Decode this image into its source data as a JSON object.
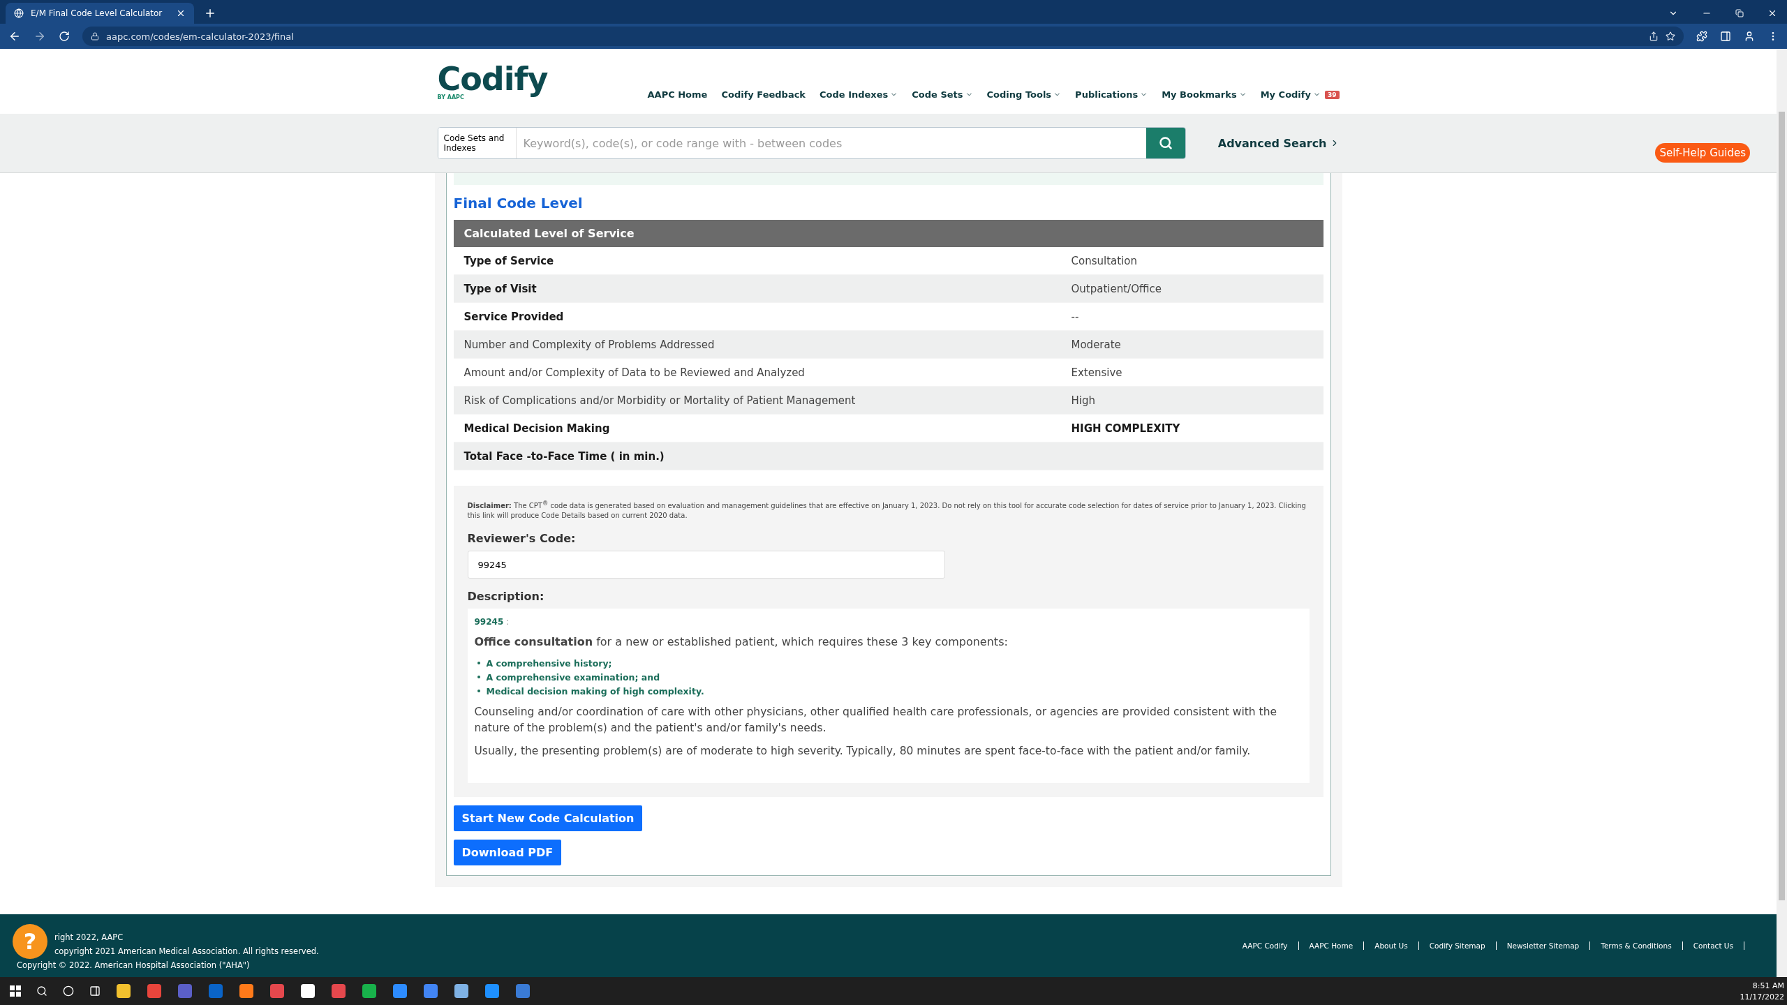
{
  "browser": {
    "tab_title": "E/M Final Code Level Calculator",
    "url": "aapc.com/codes/em-calculator-2023/final"
  },
  "header": {
    "logo": "Codify",
    "logo_sub": "BY AAPC",
    "nav": [
      {
        "label": "AAPC Home",
        "dropdown": false
      },
      {
        "label": "Codify Feedback",
        "dropdown": false
      },
      {
        "label": "Code Indexes",
        "dropdown": true
      },
      {
        "label": "Code Sets",
        "dropdown": true
      },
      {
        "label": "Coding Tools",
        "dropdown": true
      },
      {
        "label": "Publications",
        "dropdown": true
      },
      {
        "label": "My Bookmarks",
        "dropdown": true
      },
      {
        "label": "My Codify",
        "dropdown": true,
        "badge": "39"
      }
    ]
  },
  "search": {
    "scope": "Code Sets and Indexes",
    "placeholder": "Keyword(s), code(s), or code range with - between codes",
    "advanced": "Advanced Search",
    "self_help": "Self-Help Guides"
  },
  "result": {
    "title": "Final Code Level",
    "table_heading": "Calculated Level of Service",
    "rows": [
      {
        "label": "Type of Service",
        "value": "Consultation",
        "label_bold": true,
        "value_bold": false
      },
      {
        "label": "Type of Visit",
        "value": "Outpatient/Office",
        "label_bold": true,
        "value_bold": false
      },
      {
        "label": "Service Provided",
        "value": "--",
        "label_bold": true,
        "value_bold": false
      },
      {
        "label": "Number and Complexity of Problems Addressed",
        "value": "Moderate",
        "label_bold": false,
        "value_bold": false
      },
      {
        "label": "Amount and/or Complexity of Data to be Reviewed and Analyzed",
        "value": "Extensive",
        "label_bold": false,
        "value_bold": false
      },
      {
        "label": "Risk of Complications and/or Morbidity or Mortality of Patient Management",
        "value": "High",
        "label_bold": false,
        "value_bold": false
      },
      {
        "label": "Medical Decision Making",
        "value": "HIGH COMPLEXITY",
        "label_bold": true,
        "value_bold": true
      },
      {
        "label": "Total Face -to-Face Time ( in min.)",
        "label_bold": true
      }
    ]
  },
  "review": {
    "disclaimer": "**Disclaimer:** The CPT$^{®}$ code data is generated based on evaluation and management guidelines that are effective on January 1, 2023. Do not rely on this tool for accurate code selection for dates of service prior to January 1, 2023. Clicking this link will produce Code Details based on current 2020 data.",
    "code_label": "Reviewer's Code:",
    "code_value": "99245",
    "description_label": "Description:",
    "code_ref": "99245",
    "separator": ":",
    "intro": "**Office consultation** for a new or established patient, which requires these 3 key components:",
    "bullets": [
      "A comprehensive history;",
      "A comprehensive examination; and",
      "Medical decision making of high complexity."
    ],
    "paragraphs": [
      "Counseling and/or coordination of care with other physicians, other qualified health care professionals, or agencies are provided consistent with the nature of the problem(s) and the patient's and/or family's needs.",
      "Usually, the presenting problem(s) are of moderate to high severity. Typically, 80 minutes are spent face-to-face with the patient and/or family."
    ]
  },
  "buttons": [
    "Start New Code Calculation",
    "Download PDF"
  ],
  "footer": {
    "help": "?",
    "copyright": [
      "right 2022, AAPC",
      "copyright 2021 American Medical Association. All rights reserved.",
      "Copyright © 2022. American Hospital Association (\"AHA\")"
    ],
    "links": [
      "AAPC Codify",
      "AAPC Home",
      "About Us",
      "Codify Sitemap",
      "Newsletter Sitemap",
      "Terms & Conditions",
      "Contact Us"
    ]
  },
  "taskbar": {
    "time": "8:51 AM",
    "date": "11/17/2022"
  }
}
